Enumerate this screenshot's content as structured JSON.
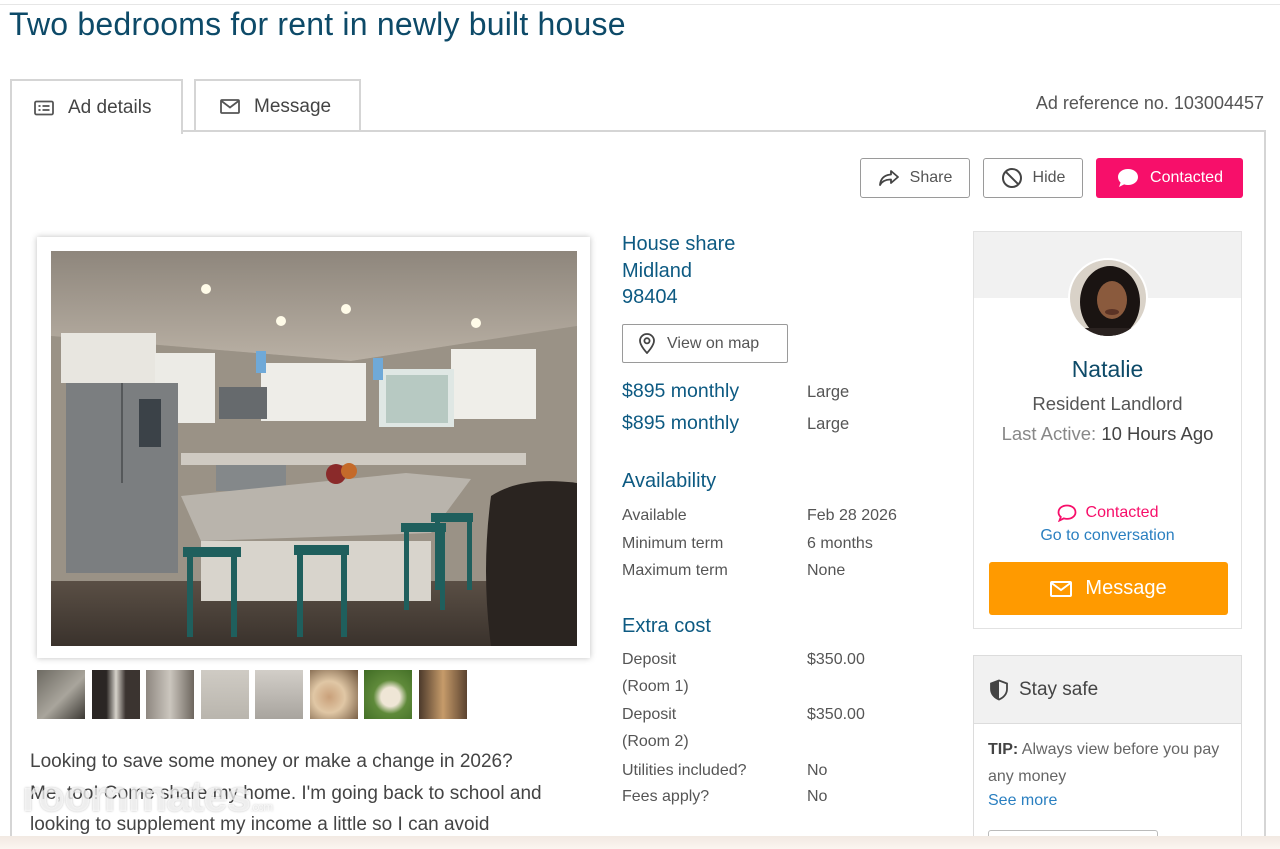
{
  "title": "Two bedrooms for rent in newly built house",
  "tabs": [
    {
      "label": "Ad details",
      "icon": "list-card-icon",
      "active": true
    },
    {
      "label": "Message",
      "icon": "envelope-icon",
      "active": false
    }
  ],
  "ad_reference": "Ad reference no. 103004457",
  "actions": {
    "share_label": "Share",
    "hide_label": "Hide",
    "contacted_label": "Contacted",
    "contacted_color": "#f70f6a"
  },
  "location": {
    "type": "House share",
    "area": "Midland",
    "postcode": "98404",
    "map_button": "View on map"
  },
  "rooms": [
    {
      "price": "$895 monthly",
      "size": "Large"
    },
    {
      "price": "$895 monthly",
      "size": "Large"
    }
  ],
  "availability": {
    "heading": "Availability",
    "rows": [
      {
        "label": "Available",
        "value": "Feb 28 2026"
      },
      {
        "label": "Minimum term",
        "value": "6 months"
      },
      {
        "label": "Maximum term",
        "value": "None"
      }
    ]
  },
  "extra_cost": {
    "heading": "Extra cost",
    "rows": [
      {
        "label": "Deposit",
        "sub": "(Room 1)",
        "value": "$350.00"
      },
      {
        "label": "Deposit",
        "sub": "(Room 2)",
        "value": "$350.00"
      },
      {
        "label": "Utilities included?",
        "value": "No"
      },
      {
        "label": "Fees apply?",
        "value": "No"
      }
    ]
  },
  "description": [
    "Looking to save some money or make a change in 2026?",
    "Me, too! Come share my home. I'm going back to school and",
    "looking to supplement my income a little so I can avoid"
  ],
  "watermark": {
    "brand": "roommates",
    "suffix": ".com"
  },
  "landlord": {
    "name": "Natalie",
    "role": "Resident Landlord",
    "last_active_label": "Last Active:",
    "last_active_value": "10 Hours Ago",
    "contacted_label": "Contacted",
    "conversation_link": "Go to conversation",
    "message_button": "Message",
    "message_color": "#ff9a00"
  },
  "stay_safe": {
    "heading": "Stay safe",
    "tip_label": "TIP:",
    "tip_text": "Always view before you pay any money",
    "see_more": "See more"
  },
  "colors": {
    "heading_blue": "#0d4a68",
    "link_blue": "#0d5a82"
  }
}
